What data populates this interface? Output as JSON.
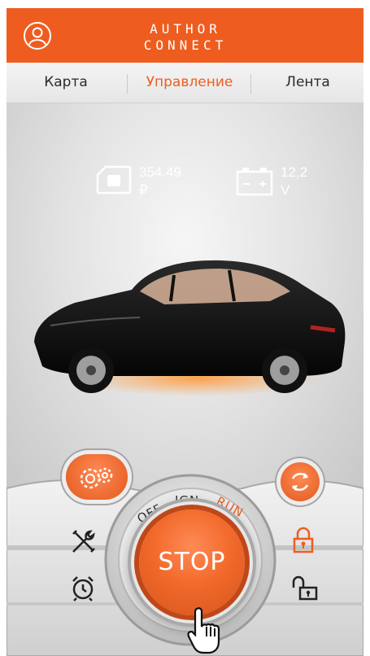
{
  "header": {
    "logo_line1": "AUTHOR",
    "logo_line2": "CONNECT",
    "brand_color": "#ee5d1f",
    "profile_icon": "user-icon"
  },
  "tabs": [
    {
      "label": "Карта",
      "active": false
    },
    {
      "label": "Управление",
      "active": true
    },
    {
      "label": "Лента",
      "active": false
    }
  ],
  "status": {
    "balance": {
      "value": "354.49",
      "unit": "₽",
      "icon": "sim-card-icon"
    },
    "battery": {
      "value": "12,2",
      "unit": "V",
      "icon": "battery-icon"
    }
  },
  "controls": {
    "ignition_positions": [
      "OFF",
      "IGN",
      "RUN"
    ],
    "active_position": "RUN",
    "stop_label": "STOP",
    "left_icons": [
      "settings-gears-icon",
      "tools-icon",
      "alarm-clock-icon"
    ],
    "right_icons": [
      "refresh-icon",
      "lock-closed-icon",
      "lock-open-icon"
    ],
    "pointer_icon": "hand-pointer-icon"
  }
}
